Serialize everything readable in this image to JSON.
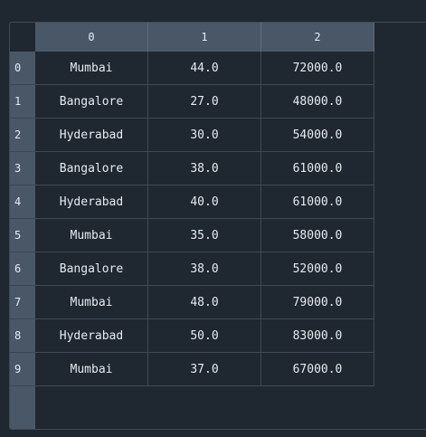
{
  "columns": [
    "0",
    "1",
    "2"
  ],
  "index": [
    "0",
    "1",
    "2",
    "3",
    "4",
    "5",
    "6",
    "7",
    "8",
    "9"
  ],
  "rows": [
    [
      "Mumbai",
      "44.0",
      "72000.0"
    ],
    [
      "Bangalore",
      "27.0",
      "48000.0"
    ],
    [
      "Hyderabad",
      "30.0",
      "54000.0"
    ],
    [
      "Bangalore",
      "38.0",
      "61000.0"
    ],
    [
      "Hyderabad",
      "40.0",
      "61000.0"
    ],
    [
      "Mumbai",
      "35.0",
      "58000.0"
    ],
    [
      "Bangalore",
      "38.0",
      "52000.0"
    ],
    [
      "Mumbai",
      "48.0",
      "79000.0"
    ],
    [
      "Hyderabad",
      "50.0",
      "83000.0"
    ],
    [
      "Mumbai",
      "37.0",
      "67000.0"
    ]
  ],
  "colors": {
    "background": "#1f2730",
    "header": "#4a5766",
    "grid_line": "#3e4a56",
    "text": "#e6ebf0"
  }
}
